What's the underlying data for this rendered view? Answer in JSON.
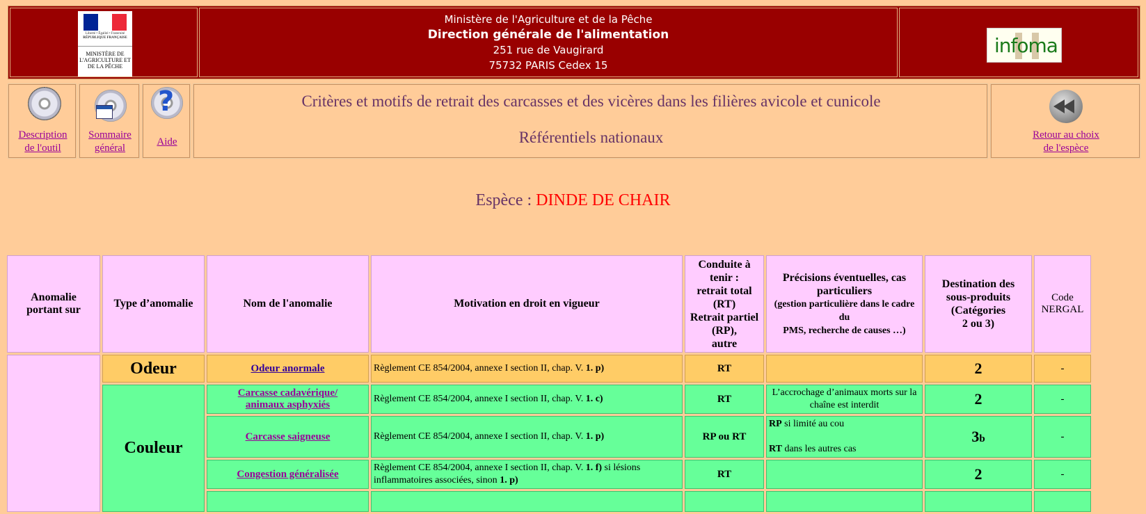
{
  "header": {
    "logo_left": {
      "motto": "Liberté • Égalité • Fraternité",
      "republic": "RÉPUBLIQUE FRANÇAISE",
      "ministry": "MINISTÈRE DE L'AGRICULTURE ET DE LA PÊCHE"
    },
    "lines": [
      "Ministère de l'Agriculture et de la Pêche",
      "Direction générale de l'alimentation",
      "251 rue de Vaugirard",
      "75732 PARIS Cedex 15"
    ],
    "logo_right": "infoma"
  },
  "nav": {
    "description": [
      "Description",
      "de l'outil"
    ],
    "sommaire": [
      "Sommaire",
      "général"
    ],
    "aide": "Aide",
    "title": "Critères et motifs de retrait des carcasses et des vicères dans les filières avicole et cunicole",
    "subtitle": "Référentiels nationaux",
    "retour": [
      "Retour au choix",
      "de l'espèce"
    ]
  },
  "espece": {
    "label": "Espèce : ",
    "value": "DINDE DE CHAIR"
  },
  "table": {
    "headers": {
      "anomalie_sur": [
        "Anomalie",
        "portant sur"
      ],
      "type": "Type d’anomalie",
      "nom": "Nom de l'anomalie",
      "motivation": "Motivation en droit en vigueur",
      "conduite": [
        "Conduite à",
        "tenir :",
        "retrait total",
        "(RT)",
        "Retrait  partiel",
        "(RP),",
        "autre"
      ],
      "precisions": [
        "Précisions éventuelles, cas particuliers",
        "(gestion particulière dans le cadre du",
        "PMS, recherche de causes …)"
      ],
      "destination": [
        "Destination des",
        "sous-produits",
        "(Catégories",
        "2 ou 3)"
      ],
      "code": [
        "Code",
        "NERGAL"
      ]
    },
    "groups": {
      "odeur": "Odeur",
      "couleur": "Couleur"
    },
    "rows": [
      {
        "nom": [
          "Odeur anormale"
        ],
        "mot_text": "Règlement CE 854/2004, annexe I section II, chap. V. ",
        "mot_bold": "1. p)",
        "conduite": "RT",
        "prec": "",
        "dest": "2",
        "code": "-"
      },
      {
        "nom": [
          "Carcasse cadavérique/",
          "animaux asphyxiés"
        ],
        "mot_text": "Règlement CE 854/2004, annexe I section II, chap. V. ",
        "mot_bold": "1. c)",
        "conduite": "RT",
        "prec": "L’accrochage d’animaux morts sur la chaîne est interdit",
        "dest": "2",
        "code": "-"
      },
      {
        "nom": [
          "Carcasse saigneuse"
        ],
        "mot_text": "Règlement CE 854/2004, annexe I section II, chap. V. ",
        "mot_bold": "1. p)",
        "conduite": "RP ou RT",
        "prec_rp_bold": "RP",
        "prec_rp": " si limité au cou",
        "prec_rt_bold": "RT",
        "prec_rt": " dans les autres cas",
        "dest": "3",
        "dest_sub": "b",
        "code": "-"
      },
      {
        "nom": [
          "Congestion généralisée"
        ],
        "mot_text": "Règlement CE 854/2004, annexe I section II, chap. V. ",
        "mot_bold": "1. f)",
        "mot_text2": " si lésions inflammatoires associées, sinon ",
        "mot_bold2": "1. p)",
        "conduite": "RT",
        "prec": "",
        "dest": "2",
        "code": "-"
      }
    ]
  },
  "colors": {
    "header_bg": "#990000",
    "page_bg": "#FFCC99",
    "header_row_bg": "#FFCCFF",
    "odeur_bg": "#FFCC66",
    "couleur_bg": "#66FF99",
    "espece_value": "#FF0000"
  }
}
